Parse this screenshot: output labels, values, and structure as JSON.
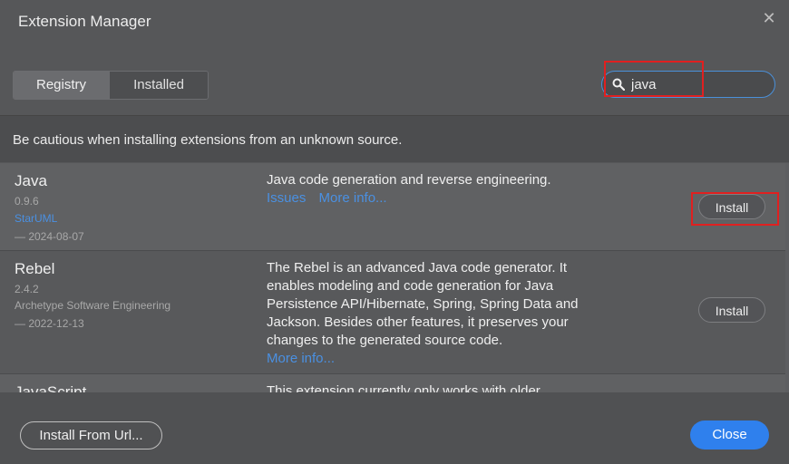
{
  "dialog": {
    "title": "Extension Manager",
    "close_icon": "close-x-icon"
  },
  "tabs": [
    {
      "label": "Registry",
      "active": true
    },
    {
      "label": "Installed",
      "active": false
    }
  ],
  "search": {
    "value": "java",
    "icon": "search-icon",
    "accent": "#4a90d9"
  },
  "warning": "Be cautious when installing extensions from an unknown source.",
  "extensions": [
    {
      "name": "Java",
      "version": "0.9.6",
      "author": "StarUML",
      "date": "— 2024-08-07",
      "description": "Java code generation and reverse engineering.",
      "links": [
        "Issues",
        "More info..."
      ],
      "action": "Install"
    },
    {
      "name": "Rebel",
      "version": "2.4.2",
      "author": "Archetype Software Engineering",
      "date": "— 2022-12-13",
      "description_lines": [
        "The Rebel is an advanced Java code generator. It",
        "enables modeling and code generation for Java",
        "Persistence API/Hibernate, Spring, Spring Data and",
        "Jackson. Besides other features, it preserves your",
        "changes to the generated source code."
      ],
      "links": [
        "More info..."
      ],
      "action": "Install"
    },
    {
      "name": "JavaScript",
      "description": "This extension currently only works with older"
    }
  ],
  "footer": {
    "install_from_url": "Install From Url...",
    "close": "Close"
  },
  "colors": {
    "link": "#4a90e2",
    "primary_button": "#2f80ed",
    "highlight": "#e02020"
  }
}
